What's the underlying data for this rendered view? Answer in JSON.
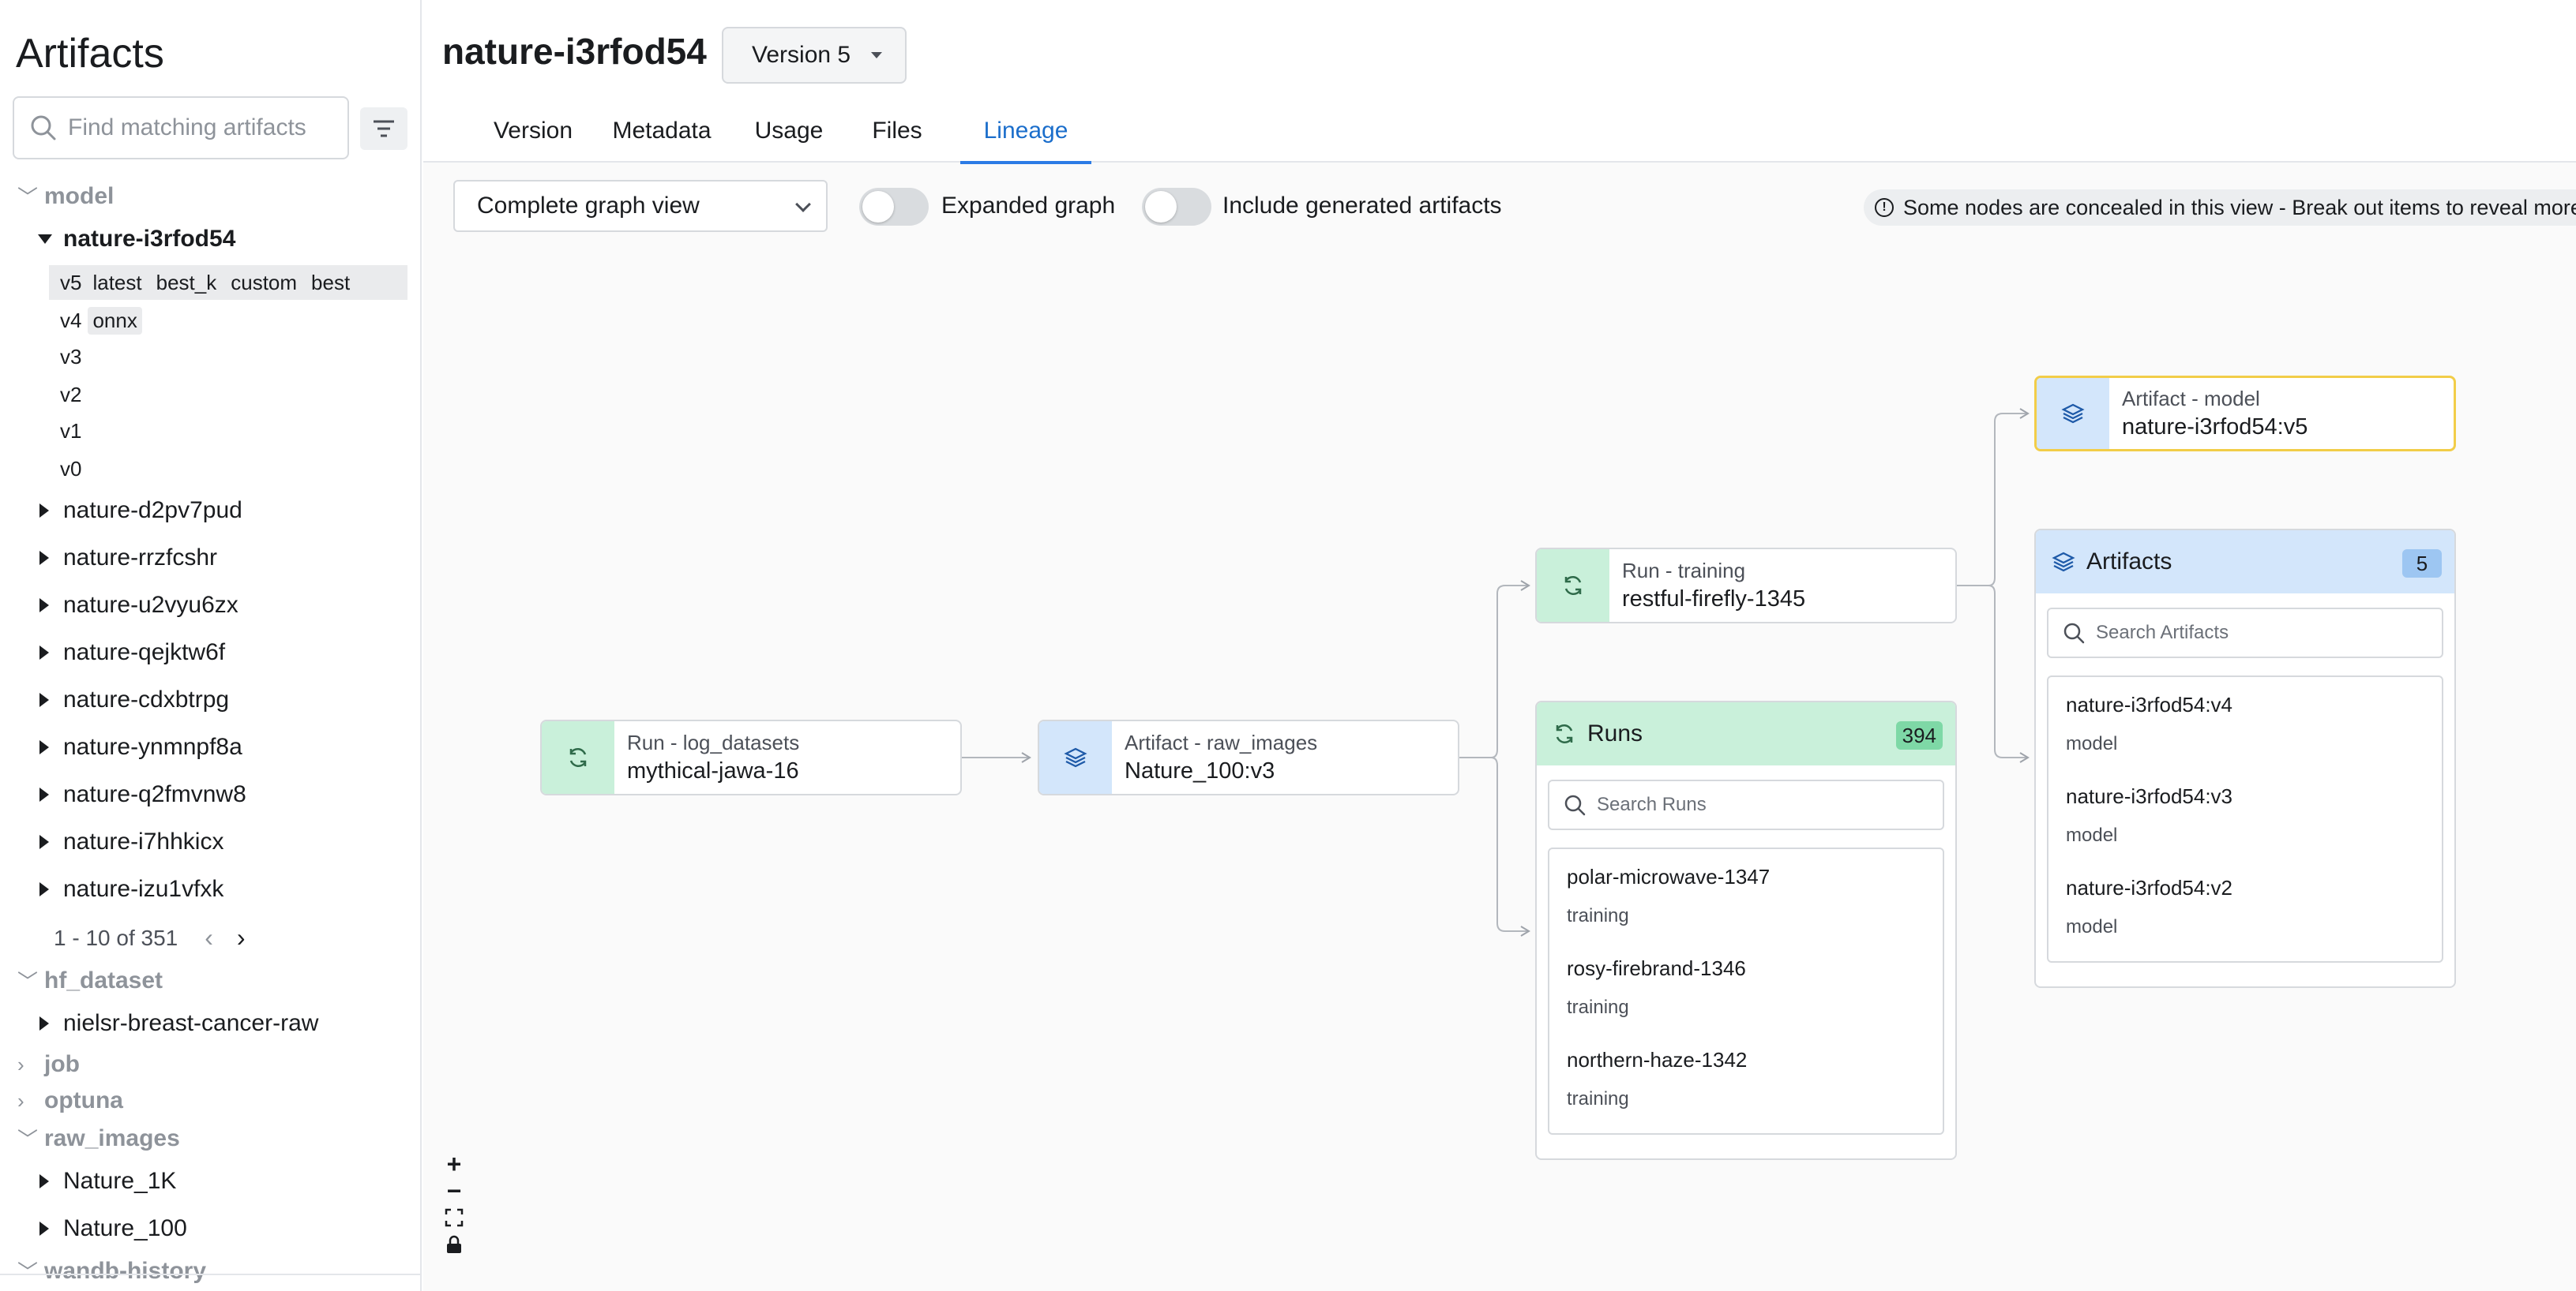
{
  "sidebar": {
    "title": "Artifacts",
    "search_placeholder": "Find matching artifacts",
    "groups": {
      "model": {
        "label": "model",
        "expanded_collection": "nature-i3rfod54",
        "versions": [
          {
            "v": "v5",
            "aliases": [
              "latest",
              "best_k",
              "custom",
              "best"
            ]
          },
          {
            "v": "v4",
            "aliases": [
              "onnx"
            ]
          },
          {
            "v": "v3",
            "aliases": []
          },
          {
            "v": "v2",
            "aliases": []
          },
          {
            "v": "v1",
            "aliases": []
          },
          {
            "v": "v0",
            "aliases": []
          }
        ],
        "collections": [
          "nature-d2pv7pud",
          "nature-rrzfcshr",
          "nature-u2vyu6zx",
          "nature-qejktw6f",
          "nature-cdxbtrpg",
          "nature-ynmnpf8a",
          "nature-q2fmvnw8",
          "nature-i7hhkicx",
          "nature-izu1vfxk"
        ],
        "pager": "1 - 10 of 351"
      },
      "hf_dataset": {
        "label": "hf_dataset",
        "collections": [
          "nielsr-breast-cancer-raw"
        ]
      },
      "job": {
        "label": "job"
      },
      "optuna": {
        "label": "optuna"
      },
      "raw_images": {
        "label": "raw_images",
        "collections": [
          "Nature_1K",
          "Nature_100"
        ]
      },
      "wandb_history": {
        "label": "wandb-history"
      }
    }
  },
  "header": {
    "title": "nature-i3rfod54",
    "version_label": "Version 5",
    "tabs": [
      "Version",
      "Metadata",
      "Usage",
      "Files",
      "Lineage"
    ],
    "active_tab": "Lineage"
  },
  "toolbar": {
    "view_select": "Complete graph view",
    "expanded_graph_label": "Expanded graph",
    "include_generated_label": "Include generated artifacts",
    "notice": "Some nodes are concealed in this view - Break out items to reveal more."
  },
  "graph": {
    "run_log": {
      "type": "Run - log_datasets",
      "name": "mythical-jawa-16"
    },
    "art_raw": {
      "type": "Artifact - raw_images",
      "name": "Nature_100:v3"
    },
    "run_train": {
      "type": "Run - training",
      "name": "restful-firefly-1345"
    },
    "art_model": {
      "type": "Artifact - model",
      "name": "nature-i3rfod54:v5"
    },
    "runs_group": {
      "title": "Runs",
      "count": "394",
      "search_placeholder": "Search Runs",
      "items": [
        {
          "name": "polar-microwave-1347",
          "sub": "training"
        },
        {
          "name": "rosy-firebrand-1346",
          "sub": "training"
        },
        {
          "name": "northern-haze-1342",
          "sub": "training"
        }
      ]
    },
    "arts_group": {
      "title": "Artifacts",
      "count": "5",
      "search_placeholder": "Search Artifacts",
      "items": [
        {
          "name": "nature-i3rfod54:v4",
          "sub": "model"
        },
        {
          "name": "nature-i3rfod54:v3",
          "sub": "model"
        },
        {
          "name": "nature-i3rfod54:v2",
          "sub": "model"
        }
      ]
    }
  },
  "zoom": {
    "plus": "+",
    "minus": "−"
  },
  "colors": {
    "accent": "#2c7be5",
    "run_bg": "#c9f0da",
    "artifact_bg": "#d3e6fb",
    "highlight": "#f2cd48"
  }
}
